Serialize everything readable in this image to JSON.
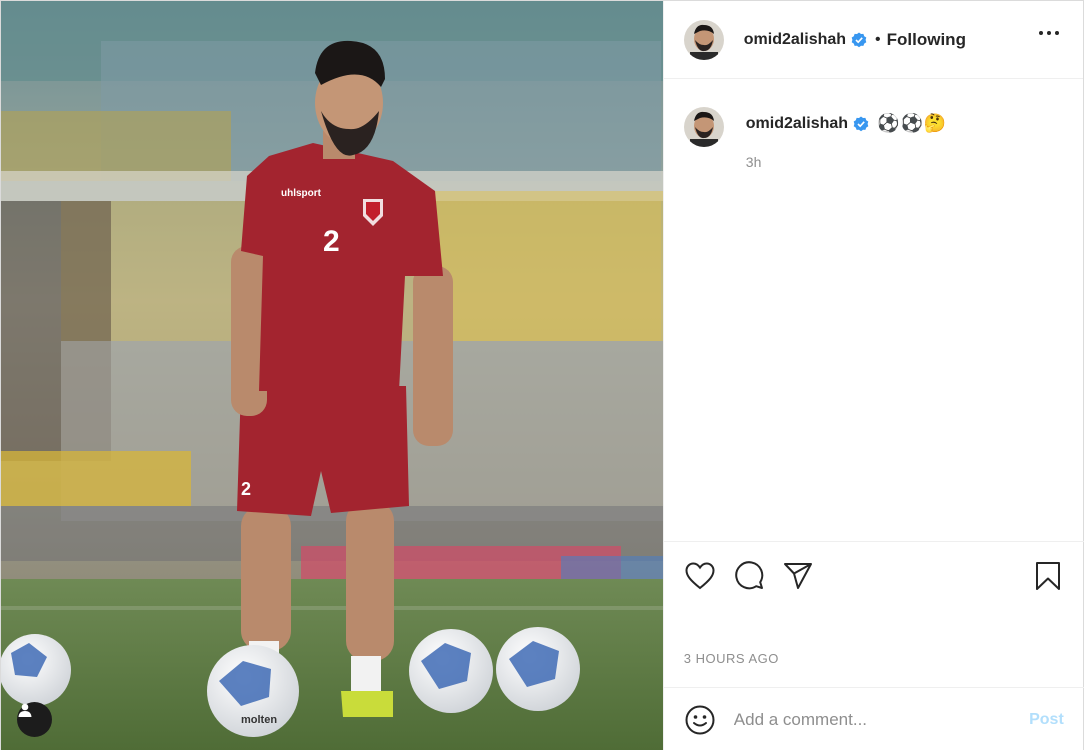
{
  "post": {
    "username": "omid2alishah",
    "follow_state": "Following",
    "separator": "•",
    "caption_text": "⚽⚽🤔",
    "relative_time": "3h",
    "timestamp": "3 HOURS AGO",
    "photo_alt": "Footballer in red training kit standing among footballs on a stadium pitch"
  },
  "comment": {
    "placeholder": "Add a comment...",
    "post_label": "Post"
  },
  "colors": {
    "verified": "#3897f0",
    "kit_red": "#a3242f",
    "post_disabled": "#b2dffc",
    "muted_text": "#8e8e8e"
  },
  "icons": [
    "heart-icon",
    "comment-icon",
    "share-icon",
    "bookmark-icon",
    "more-icon",
    "emoji-icon",
    "verified-icon",
    "user-tag-icon"
  ]
}
